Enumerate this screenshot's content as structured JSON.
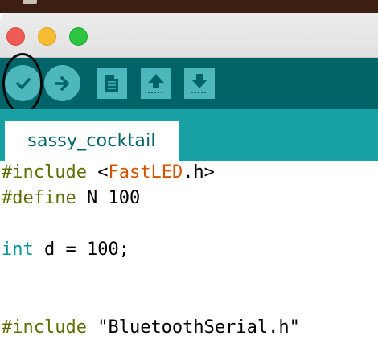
{
  "window": {
    "tab_label": "sassy_cocktail"
  },
  "toolbar": {
    "buttons": [
      {
        "name": "verify",
        "icon": "checkmark-icon",
        "shape": "round"
      },
      {
        "name": "upload",
        "icon": "arrow-right-icon",
        "shape": "round"
      },
      {
        "name": "new",
        "icon": "document-icon",
        "shape": "square"
      },
      {
        "name": "open",
        "icon": "arrow-up-icon",
        "shape": "square"
      },
      {
        "name": "save",
        "icon": "arrow-down-icon",
        "shape": "square"
      }
    ]
  },
  "colors": {
    "toolbar_bg": "#006468",
    "tabstrip_bg": "#17a1a5",
    "button_bg": "#4db7bb",
    "keyword": "#5e6d03",
    "library": "#d35400",
    "type": "#00979c"
  },
  "code": {
    "line1": {
      "directive": "#include",
      "open": " <",
      "lib": "FastLED",
      "close": ".h>"
    },
    "line2": {
      "directive": "#define",
      "rest": " N 100"
    },
    "line3": "",
    "line4": {
      "type": "int",
      "rest": " d = 100;"
    },
    "line5": "",
    "line6": "",
    "line7": {
      "directive": "#include",
      "rest": " \"BluetoothSerial.h\""
    }
  }
}
